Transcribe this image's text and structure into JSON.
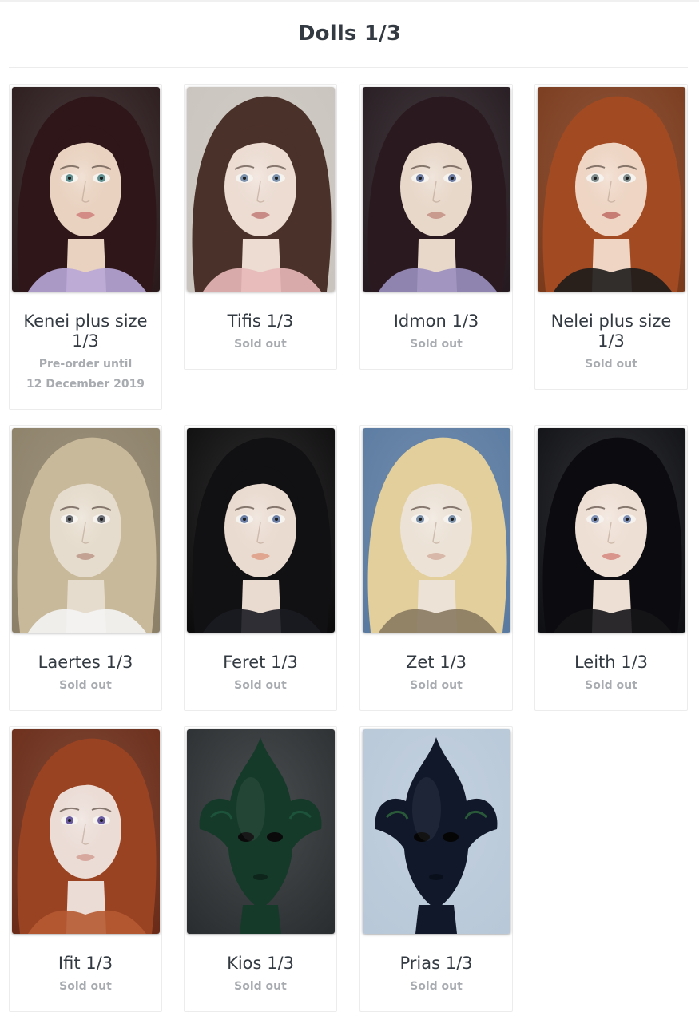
{
  "page": {
    "title": "Dolls 1/3"
  },
  "products": [
    {
      "name": "Kenei plus size 1/3",
      "status": "Pre-order until",
      "status2": "12 December 2019",
      "image": "doll-photo-kenei",
      "palette": {
        "bg": "#2a1a1c",
        "hair": "#2e1619",
        "skin": "#e9d2c0",
        "eye": "#5f8f8e",
        "lip": "#d48d86",
        "accent": "#b8a6d8"
      }
    },
    {
      "name": "Tifis 1/3",
      "status": "Sold out",
      "image": "doll-photo-tifis",
      "palette": {
        "bg": "#c9c4bd",
        "hair": "#4a3129",
        "skin": "#ecdcd2",
        "eye": "#7d92ad",
        "lip": "#c98b86",
        "accent": "#e8b8b8"
      }
    },
    {
      "name": "Idmon 1/3",
      "status": "Sold out",
      "image": "doll-photo-idmon",
      "palette": {
        "bg": "#241a1f",
        "hair": "#2a1a20",
        "skin": "#e8d8ca",
        "eye": "#6b7aa0",
        "lip": "#c99a8e",
        "accent": "#9a8fbf"
      }
    },
    {
      "name": "Nelei plus size 1/3",
      "status": "Sold out",
      "image": "doll-photo-nelei",
      "palette": {
        "bg": "#7a3a1c",
        "hair": "#a24a22",
        "skin": "#eed5c4",
        "eye": "#7f8a8a",
        "lip": "#c77c74",
        "accent": "#1c1c1c"
      }
    },
    {
      "name": "Laertes 1/3",
      "status": "Sold out",
      "image": "doll-photo-laertes",
      "palette": {
        "bg": "#8c8068",
        "hair": "#c8b99a",
        "skin": "#e6dccd",
        "eye": "#6b6f74",
        "lip": "#c3a293",
        "accent": "#f4f4f4"
      }
    },
    {
      "name": "Feret 1/3",
      "status": "Sold out",
      "image": "doll-photo-feret",
      "palette": {
        "bg": "#0d0c0d",
        "hair": "#111012",
        "skin": "#eadbd0",
        "eye": "#6d7ea5",
        "lip": "#e0a68f",
        "accent": "#1b1b22"
      }
    },
    {
      "name": "Zet 1/3",
      "status": "Sold out",
      "image": "doll-photo-zet",
      "palette": {
        "bg": "#5a7aa0",
        "hair": "#e2cf9c",
        "skin": "#ece2d6",
        "eye": "#7a8fa8",
        "lip": "#d8b8a8",
        "accent": "#8a7a62"
      }
    },
    {
      "name": "Leith 1/3",
      "status": "Sold out",
      "image": "doll-photo-leith",
      "palette": {
        "bg": "#0f1014",
        "hair": "#0c0c10",
        "skin": "#eedfd4",
        "eye": "#7d8eb2",
        "lip": "#d9958c",
        "accent": "#151518"
      }
    },
    {
      "name": "Ifit 1/3",
      "status": "Sold out",
      "image": "doll-photo-ifit",
      "palette": {
        "bg": "#6a2c18",
        "hair": "#9a4322",
        "skin": "#ebdcd6",
        "eye": "#6a5aa0",
        "lip": "#d7a89e",
        "accent": "#b65a32"
      }
    },
    {
      "name": "Kios 1/3",
      "status": "Sold out",
      "image": "doll-photo-kios",
      "palette": {
        "bg": "#2a2e30",
        "hair": "#0f2a1e",
        "skin": "#163a2a",
        "eye": "#0a0a0a",
        "lip": "#0d241a",
        "accent": "#1f5a3e"
      }
    },
    {
      "name": "Prias 1/3",
      "status": "Sold out",
      "image": "doll-photo-prias",
      "palette": {
        "bg": "#b8c8d8",
        "hair": "#0c1220",
        "skin": "#10182a",
        "eye": "#050505",
        "lip": "#0a0f1a",
        "accent": "#2f6a3c"
      }
    }
  ]
}
